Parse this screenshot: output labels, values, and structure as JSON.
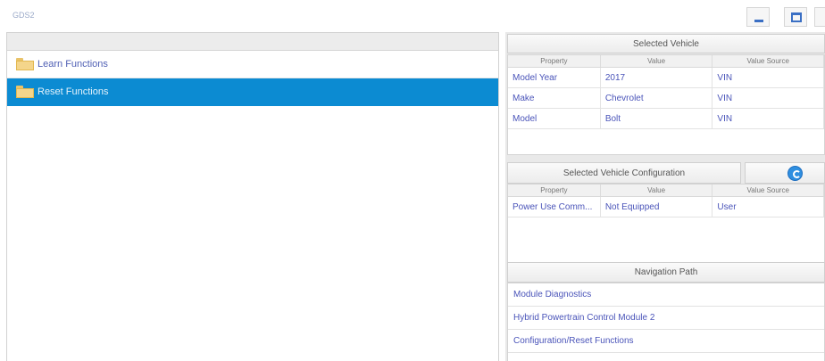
{
  "app": {
    "label": "GDS2"
  },
  "window": {
    "minimize_icon": "minimize-icon",
    "maximize_icon": "maximize-icon"
  },
  "tree": {
    "items": [
      {
        "label": "Learn Functions",
        "icon": "folder-icon",
        "selected": false
      },
      {
        "label": "Reset Functions",
        "icon": "folder-icon",
        "selected": true
      }
    ]
  },
  "selected_vehicle": {
    "title": "Selected Vehicle",
    "columns": [
      "Property",
      "Value",
      "Value Source"
    ],
    "rows": [
      [
        "Model Year",
        "2017",
        "VIN"
      ],
      [
        "Make",
        "Chevrolet",
        "VIN"
      ],
      [
        "Model",
        "Bolt",
        "VIN"
      ]
    ]
  },
  "vehicle_config": {
    "title": "Selected Vehicle Configuration",
    "refresh_icon": "refresh-icon",
    "columns": [
      "Property",
      "Value",
      "Value Source"
    ],
    "rows": [
      [
        "Power Use Comm...",
        "Not Equipped",
        "User"
      ]
    ]
  },
  "navigation_path": {
    "title": "Navigation Path",
    "items": [
      "Module Diagnostics",
      "Hybrid Powertrain Control Module 2",
      "Configuration/Reset Functions"
    ]
  }
}
